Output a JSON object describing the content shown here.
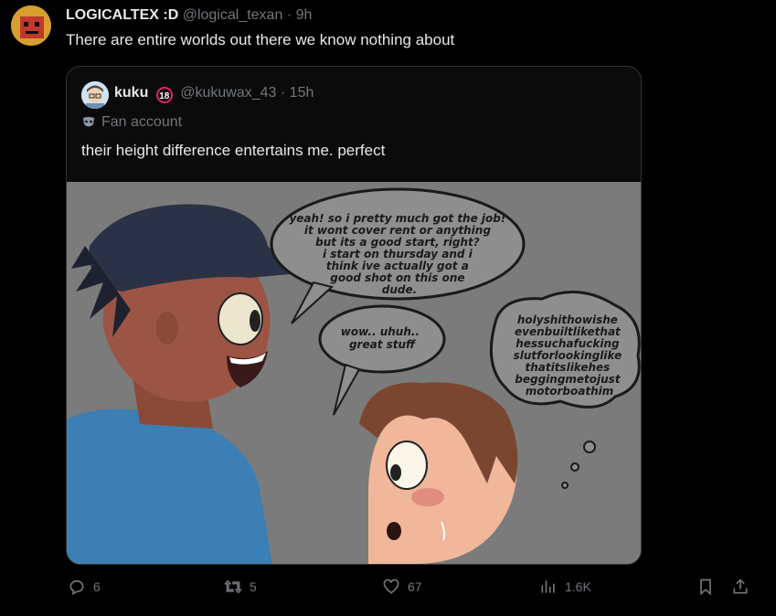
{
  "tweet": {
    "author_name": "LOGICALTEX :D",
    "author_handle": "@logical_texan",
    "time": "9h",
    "text": "There are entire worlds out there we know nothing about"
  },
  "quote": {
    "author_name": "kuku",
    "badge": "18",
    "author_handle": "@kukuwax_43",
    "time": "15h",
    "label": "Fan account",
    "text": "their height difference entertains me. perfect",
    "comic": {
      "bubble1": [
        "yeah! so i pretty much got the job!",
        "it wont cover rent or anything",
        "but its a good start, right?",
        "i start on thursday and i",
        "think ive actually got a",
        "good shot on this one",
        "dude."
      ],
      "bubble2": [
        "wow.. uhuh..",
        "great stuff"
      ],
      "thought": [
        "holyshithowishe",
        "evenbuiltlikethat",
        "hessuchafucking",
        "slutforlookinglike",
        "thatitslikehes",
        "beggingmetojust",
        "motorboathim"
      ]
    }
  },
  "actions": {
    "replies": "6",
    "reposts": "5",
    "likes": "67",
    "views": "1.6K"
  },
  "colors": {
    "muted": "#71767b",
    "text": "#e7e9ea",
    "border": "#2f3336",
    "background": "#000000"
  }
}
